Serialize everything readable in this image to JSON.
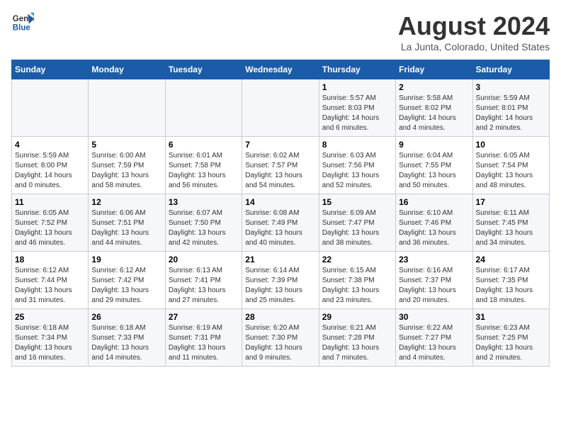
{
  "logo": {
    "line1": "General",
    "line2": "Blue"
  },
  "title": "August 2024",
  "subtitle": "La Junta, Colorado, United States",
  "days_of_week": [
    "Sunday",
    "Monday",
    "Tuesday",
    "Wednesday",
    "Thursday",
    "Friday",
    "Saturday"
  ],
  "weeks": [
    [
      {
        "day": "",
        "info": ""
      },
      {
        "day": "",
        "info": ""
      },
      {
        "day": "",
        "info": ""
      },
      {
        "day": "",
        "info": ""
      },
      {
        "day": "1",
        "info": "Sunrise: 5:57 AM\nSunset: 8:03 PM\nDaylight: 14 hours\nand 6 minutes."
      },
      {
        "day": "2",
        "info": "Sunrise: 5:58 AM\nSunset: 8:02 PM\nDaylight: 14 hours\nand 4 minutes."
      },
      {
        "day": "3",
        "info": "Sunrise: 5:59 AM\nSunset: 8:01 PM\nDaylight: 14 hours\nand 2 minutes."
      }
    ],
    [
      {
        "day": "4",
        "info": "Sunrise: 5:59 AM\nSunset: 8:00 PM\nDaylight: 14 hours\nand 0 minutes."
      },
      {
        "day": "5",
        "info": "Sunrise: 6:00 AM\nSunset: 7:59 PM\nDaylight: 13 hours\nand 58 minutes."
      },
      {
        "day": "6",
        "info": "Sunrise: 6:01 AM\nSunset: 7:58 PM\nDaylight: 13 hours\nand 56 minutes."
      },
      {
        "day": "7",
        "info": "Sunrise: 6:02 AM\nSunset: 7:57 PM\nDaylight: 13 hours\nand 54 minutes."
      },
      {
        "day": "8",
        "info": "Sunrise: 6:03 AM\nSunset: 7:56 PM\nDaylight: 13 hours\nand 52 minutes."
      },
      {
        "day": "9",
        "info": "Sunrise: 6:04 AM\nSunset: 7:55 PM\nDaylight: 13 hours\nand 50 minutes."
      },
      {
        "day": "10",
        "info": "Sunrise: 6:05 AM\nSunset: 7:54 PM\nDaylight: 13 hours\nand 48 minutes."
      }
    ],
    [
      {
        "day": "11",
        "info": "Sunrise: 6:05 AM\nSunset: 7:52 PM\nDaylight: 13 hours\nand 46 minutes."
      },
      {
        "day": "12",
        "info": "Sunrise: 6:06 AM\nSunset: 7:51 PM\nDaylight: 13 hours\nand 44 minutes."
      },
      {
        "day": "13",
        "info": "Sunrise: 6:07 AM\nSunset: 7:50 PM\nDaylight: 13 hours\nand 42 minutes."
      },
      {
        "day": "14",
        "info": "Sunrise: 6:08 AM\nSunset: 7:49 PM\nDaylight: 13 hours\nand 40 minutes."
      },
      {
        "day": "15",
        "info": "Sunrise: 6:09 AM\nSunset: 7:47 PM\nDaylight: 13 hours\nand 38 minutes."
      },
      {
        "day": "16",
        "info": "Sunrise: 6:10 AM\nSunset: 7:46 PM\nDaylight: 13 hours\nand 36 minutes."
      },
      {
        "day": "17",
        "info": "Sunrise: 6:11 AM\nSunset: 7:45 PM\nDaylight: 13 hours\nand 34 minutes."
      }
    ],
    [
      {
        "day": "18",
        "info": "Sunrise: 6:12 AM\nSunset: 7:44 PM\nDaylight: 13 hours\nand 31 minutes."
      },
      {
        "day": "19",
        "info": "Sunrise: 6:12 AM\nSunset: 7:42 PM\nDaylight: 13 hours\nand 29 minutes."
      },
      {
        "day": "20",
        "info": "Sunrise: 6:13 AM\nSunset: 7:41 PM\nDaylight: 13 hours\nand 27 minutes."
      },
      {
        "day": "21",
        "info": "Sunrise: 6:14 AM\nSunset: 7:39 PM\nDaylight: 13 hours\nand 25 minutes."
      },
      {
        "day": "22",
        "info": "Sunrise: 6:15 AM\nSunset: 7:38 PM\nDaylight: 13 hours\nand 23 minutes."
      },
      {
        "day": "23",
        "info": "Sunrise: 6:16 AM\nSunset: 7:37 PM\nDaylight: 13 hours\nand 20 minutes."
      },
      {
        "day": "24",
        "info": "Sunrise: 6:17 AM\nSunset: 7:35 PM\nDaylight: 13 hours\nand 18 minutes."
      }
    ],
    [
      {
        "day": "25",
        "info": "Sunrise: 6:18 AM\nSunset: 7:34 PM\nDaylight: 13 hours\nand 16 minutes."
      },
      {
        "day": "26",
        "info": "Sunrise: 6:18 AM\nSunset: 7:33 PM\nDaylight: 13 hours\nand 14 minutes."
      },
      {
        "day": "27",
        "info": "Sunrise: 6:19 AM\nSunset: 7:31 PM\nDaylight: 13 hours\nand 11 minutes."
      },
      {
        "day": "28",
        "info": "Sunrise: 6:20 AM\nSunset: 7:30 PM\nDaylight: 13 hours\nand 9 minutes."
      },
      {
        "day": "29",
        "info": "Sunrise: 6:21 AM\nSunset: 7:28 PM\nDaylight: 13 hours\nand 7 minutes."
      },
      {
        "day": "30",
        "info": "Sunrise: 6:22 AM\nSunset: 7:27 PM\nDaylight: 13 hours\nand 4 minutes."
      },
      {
        "day": "31",
        "info": "Sunrise: 6:23 AM\nSunset: 7:25 PM\nDaylight: 13 hours\nand 2 minutes."
      }
    ]
  ]
}
